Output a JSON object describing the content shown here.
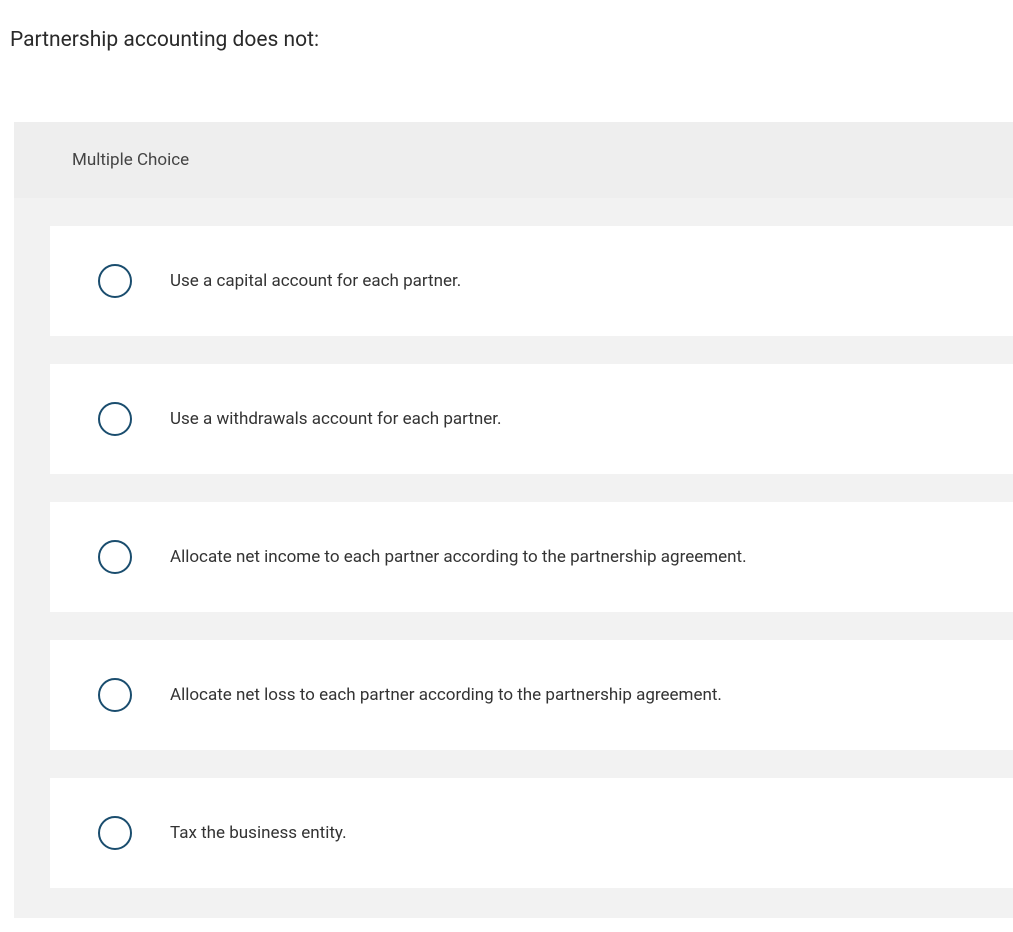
{
  "question": "Partnership accounting does not:",
  "section_label": "Multiple Choice",
  "options": [
    {
      "label": "Use a capital account for each partner."
    },
    {
      "label": "Use a withdrawals account for each partner."
    },
    {
      "label": "Allocate net income to each partner according to the partnership agreement."
    },
    {
      "label": "Allocate net loss to each partner according to the partnership agreement."
    },
    {
      "label": "Tax the business entity."
    }
  ]
}
